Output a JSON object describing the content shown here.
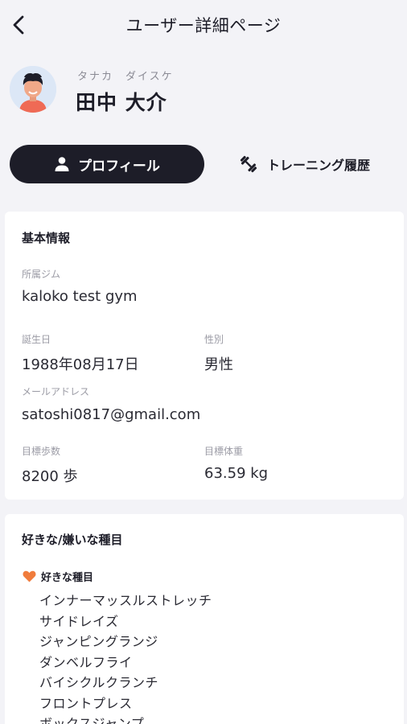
{
  "header": {
    "title": "ユーザー詳細ページ",
    "back_icon": "chevron-left-icon"
  },
  "user": {
    "name_kana": "タナカ　ダイスケ",
    "name": "田中 大介"
  },
  "tabs": {
    "profile": {
      "label": "プロフィール",
      "icon": "person-icon",
      "active": true
    },
    "history": {
      "label": "トレーニング履歴",
      "icon": "dumbbell-icon",
      "active": false
    }
  },
  "basic_info": {
    "title": "基本情報",
    "gym_label": "所属ジム",
    "gym_value": "kaloko test gym",
    "birthday_label": "誕生日",
    "birthday_value": "1988年08月17日",
    "gender_label": "性別",
    "gender_value": "男性",
    "email_label": "メールアドレス",
    "email_value": "satoshi0817@gmail.com",
    "steps_label": "目標歩数",
    "steps_value": "8200 歩",
    "weight_label": "目標体重",
    "weight_value": "63.59 kg"
  },
  "preferences": {
    "title": "好きな/嫌いな種目",
    "likes_label": "好きな種目",
    "likes": [
      "インナーマッスルストレッチ",
      "サイドレイズ",
      "ジャンピングランジ",
      "ダンベルフライ",
      "バイシクルクランチ",
      "フロントプレス",
      "ボックスジャンプ"
    ]
  },
  "colors": {
    "primary": "#1d1d28",
    "background": "#f3f3f7",
    "heart": "#f07c3c",
    "avatar_bg": "#dce7f6"
  }
}
